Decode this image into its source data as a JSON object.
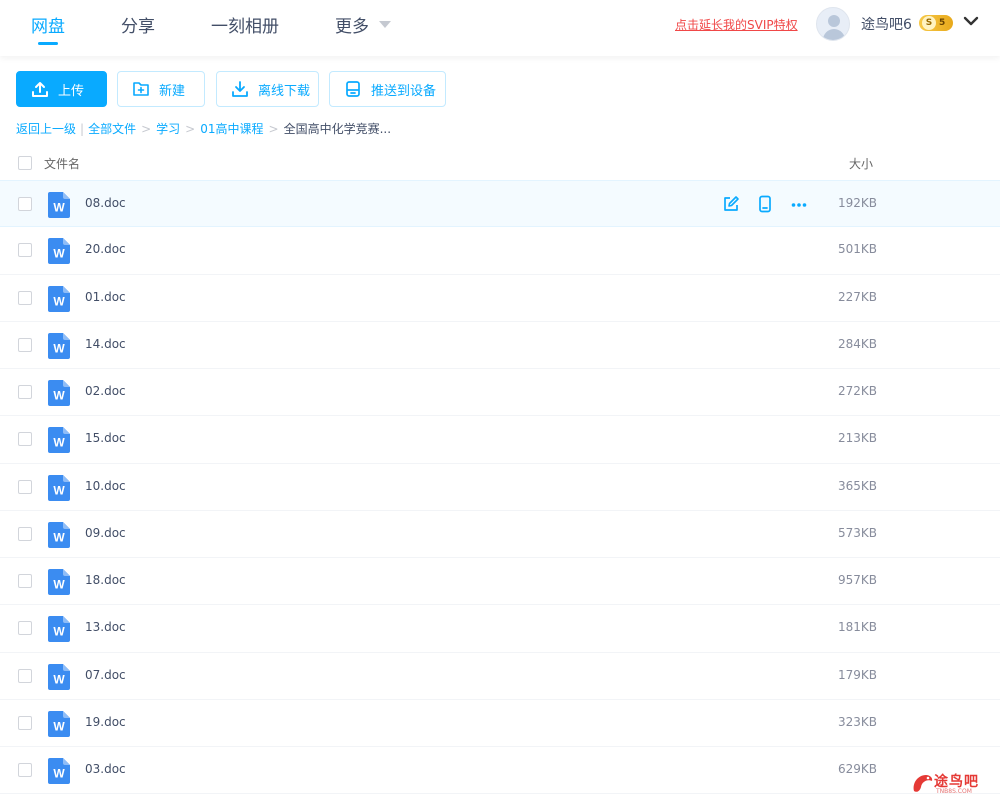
{
  "nav": {
    "tabs": [
      {
        "label": "网盘",
        "active": true
      },
      {
        "label": "分享",
        "active": false
      },
      {
        "label": "一刻相册",
        "active": false
      },
      {
        "label": "更多",
        "active": false
      }
    ],
    "svip_link": "点击延长我的SVIP特权",
    "username": "途鸟吧6",
    "vip_level": "5",
    "vip_badge_letter": "S"
  },
  "toolbar": {
    "upload": "上传",
    "new": "新建",
    "offline_download": "离线下载",
    "push_device": "推送到设备"
  },
  "breadcrumb": {
    "back": "返回上一级",
    "items": [
      "全部文件",
      "学习",
      "01高中课程"
    ],
    "current": "全国高中化学竞赛..."
  },
  "table": {
    "col_name": "文件名",
    "col_size": "大小",
    "rows": [
      {
        "name": "08.doc",
        "size": "192KB",
        "hover": true
      },
      {
        "name": "20.doc",
        "size": "501KB"
      },
      {
        "name": "01.doc",
        "size": "227KB"
      },
      {
        "name": "14.doc",
        "size": "284KB"
      },
      {
        "name": "02.doc",
        "size": "272KB"
      },
      {
        "name": "15.doc",
        "size": "213KB"
      },
      {
        "name": "10.doc",
        "size": "365KB"
      },
      {
        "name": "09.doc",
        "size": "573KB"
      },
      {
        "name": "18.doc",
        "size": "957KB"
      },
      {
        "name": "13.doc",
        "size": "181KB"
      },
      {
        "name": "07.doc",
        "size": "179KB"
      },
      {
        "name": "19.doc",
        "size": "323KB"
      },
      {
        "name": "03.doc",
        "size": "629KB"
      }
    ],
    "file_icon_letter": "W"
  },
  "watermark": {
    "text": "途鸟吧",
    "sub": "TNB8S.COM"
  },
  "colors": {
    "accent": "#09aaff",
    "svip": "#f04848",
    "word_icon": "#3b8cf1"
  }
}
